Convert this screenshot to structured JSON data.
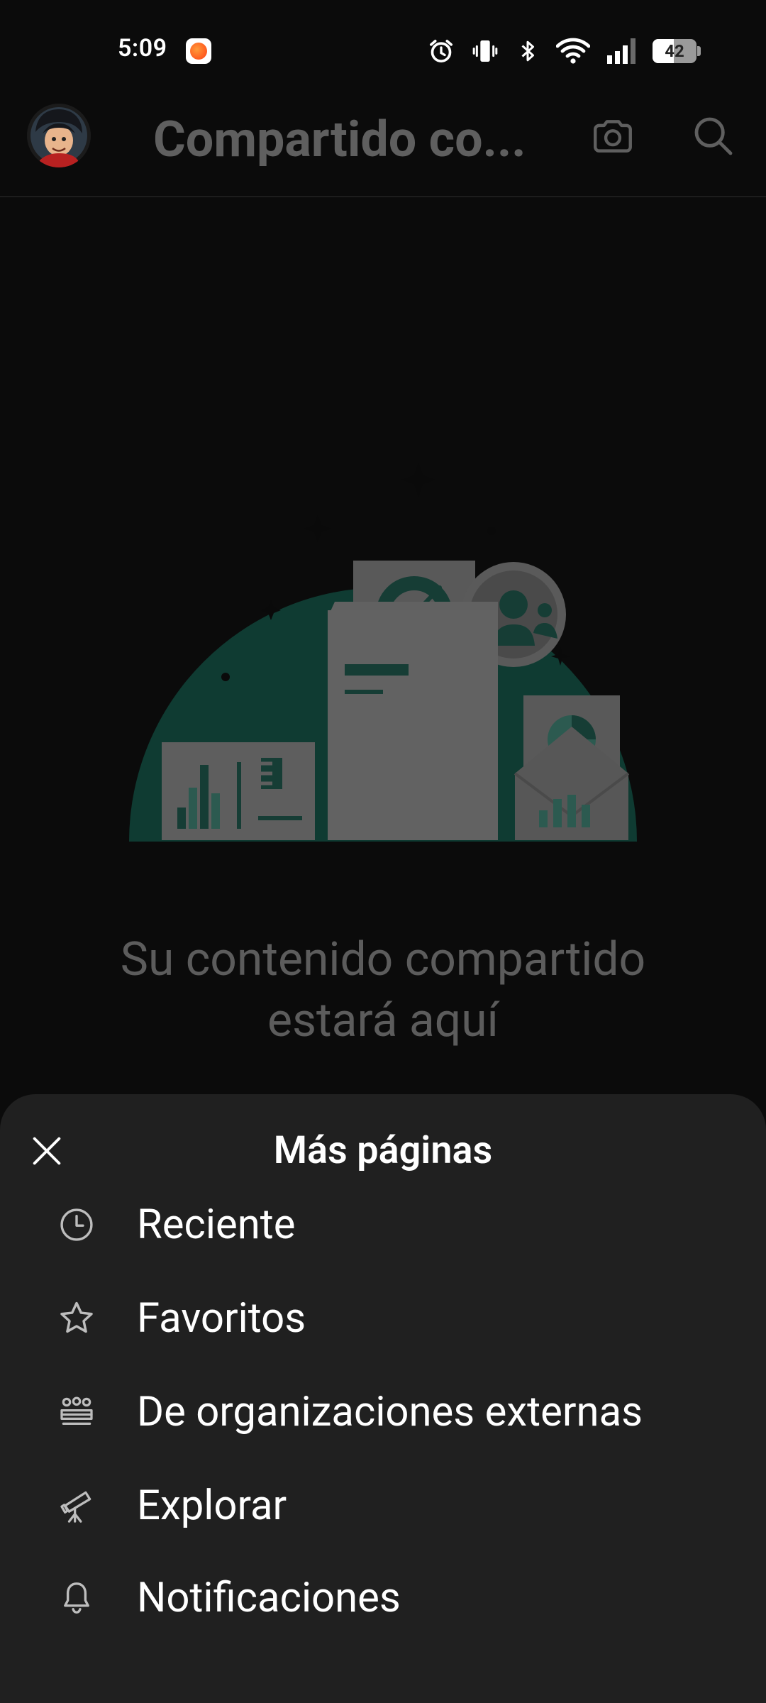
{
  "status_bar": {
    "time": "5:09",
    "battery": "42"
  },
  "app_bar": {
    "title": "Compartido co..."
  },
  "empty_state": {
    "line1": "Su contenido compartido",
    "line2": "estará aquí"
  },
  "sheet": {
    "title": "Más páginas",
    "items": [
      {
        "label": "Reciente",
        "icon": "clock-icon"
      },
      {
        "label": "Favoritos",
        "icon": "star-icon"
      },
      {
        "label": "De organizaciones externas",
        "icon": "people-group-icon"
      },
      {
        "label": "Explorar",
        "icon": "telescope-icon"
      },
      {
        "label": "Notificaciones",
        "icon": "bell-icon"
      }
    ]
  },
  "colors": {
    "background": "#0b0b0b",
    "sheet": "#202020",
    "illustration_circle": "#0f3b32",
    "muted_text": "#5c5c5c"
  }
}
